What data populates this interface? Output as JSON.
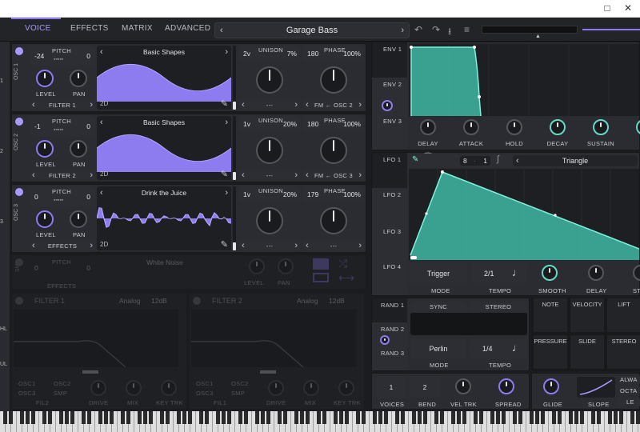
{
  "window": {
    "maximize_icon": "□",
    "close_icon": "✕"
  },
  "header": {
    "tabs": [
      "VOICE",
      "EFFECTS",
      "MATRIX",
      "ADVANCED"
    ],
    "preset_name": "Garage Bass"
  },
  "osc": [
    {
      "label": "OSC 1",
      "pitch_label": "PITCH",
      "transpose": "-24",
      "tune": "0",
      "table": "Basic Shapes",
      "unison_voices": "2v",
      "unison_label": "UNISON",
      "unison_detune": "7%",
      "phase": "180",
      "phase_label": "PHASE",
      "phase_rand": "100%",
      "route": "FILTER 1",
      "fm": "FM ← OSC 2",
      "sub": "---",
      "mode": "2D",
      "level_label": "LEVEL",
      "pan_label": "PAN"
    },
    {
      "label": "OSC 2",
      "pitch_label": "PITCH",
      "transpose": "-1",
      "tune": "0",
      "table": "Basic Shapes",
      "unison_voices": "1v",
      "unison_label": "UNISON",
      "unison_detune": "20%",
      "phase": "180",
      "phase_label": "PHASE",
      "phase_rand": "100%",
      "route": "FILTER 2",
      "fm": "FM ← OSC 3",
      "sub": "---",
      "mode": "2D",
      "level_label": "LEVEL",
      "pan_label": "PAN"
    },
    {
      "label": "OSC 3",
      "pitch_label": "PITCH",
      "transpose": "0",
      "tune": "0",
      "table": "Drink the Juice",
      "unison_voices": "1v",
      "unison_label": "UNISON",
      "unison_detune": "20%",
      "phase": "179",
      "phase_label": "PHASE",
      "phase_rand": "100%",
      "route": "EFFECTS",
      "fm": "---",
      "sub": "---",
      "mode": "2D",
      "level_label": "LEVEL",
      "pan_label": "PAN"
    }
  ],
  "smp": {
    "label": "SMP",
    "pitch_label": "PITCH",
    "transpose": "0",
    "tune": "0",
    "sample": "White Noise",
    "route": "EFFECTS",
    "level_label": "LEVEL",
    "pan_label": "PAN"
  },
  "filters": [
    {
      "name": "FILTER 1",
      "model": "Analog",
      "slope": "12dB",
      "osc1": "OSC1",
      "osc2": "OSC2",
      "osc3": "OSC3",
      "smp": "SMP",
      "fil": "FIL2",
      "drive": "DRIVE",
      "mix": "MIX",
      "keytrk": "KEY TRK"
    },
    {
      "name": "FILTER 2",
      "model": "Analog",
      "slope": "12dB",
      "osc1": "OSC1",
      "osc2": "OSC2",
      "osc3": "OSC3",
      "smp": "SMP",
      "fil": "FIL1",
      "drive": "DRIVE",
      "mix": "MIX",
      "keytrk": "KEY TRK"
    }
  ],
  "env": {
    "tabs": [
      "ENV 1",
      "ENV 2",
      "ENV 3"
    ],
    "knobs": [
      "DELAY",
      "ATTACK",
      "HOLD",
      "DECAY",
      "SUSTAIN",
      "R"
    ]
  },
  "lfo": {
    "tabs": [
      "LFO 1",
      "LFO 2",
      "LFO 3",
      "LFO 4"
    ],
    "shape": "Triangle",
    "grid_x": "8",
    "grid_y": "1",
    "mode": "Trigger",
    "mode_label": "MODE",
    "tempo": "2/1",
    "tempo_label": "TEMPO",
    "smooth": "SMOOTH",
    "delay": "DELAY",
    "stereo": "ST"
  },
  "rand": {
    "tabs": [
      "RAND 1",
      "RAND 2",
      "RAND 3"
    ],
    "sync": "SYNC",
    "stereo": "STEREO",
    "style": "Perlin",
    "mode_label": "MODE",
    "tempo": "1/4",
    "tempo_label": "TEMPO"
  },
  "sources": [
    "NOTE",
    "VELOCITY",
    "LIFT",
    "PRESSURE",
    "SLIDE",
    "STEREO"
  ],
  "voice": {
    "voices": "1",
    "voices_label": "VOICES",
    "bend": "2",
    "bend_label": "BEND",
    "veltrk": "VEL TRK",
    "spread": "SPREAD",
    "glide": "GLIDE",
    "slope": "SLOPE",
    "always": "ALWA",
    "octave": "OCTA",
    "legato": "LE"
  },
  "sidebar_left": [
    "1",
    "2",
    "3",
    "HL",
    "UL"
  ],
  "colors": {
    "accent": "#8c7cf0",
    "teal": "#3fb8a5",
    "teal_light": "#7ff2dc",
    "bg": "#1b1c1f"
  }
}
